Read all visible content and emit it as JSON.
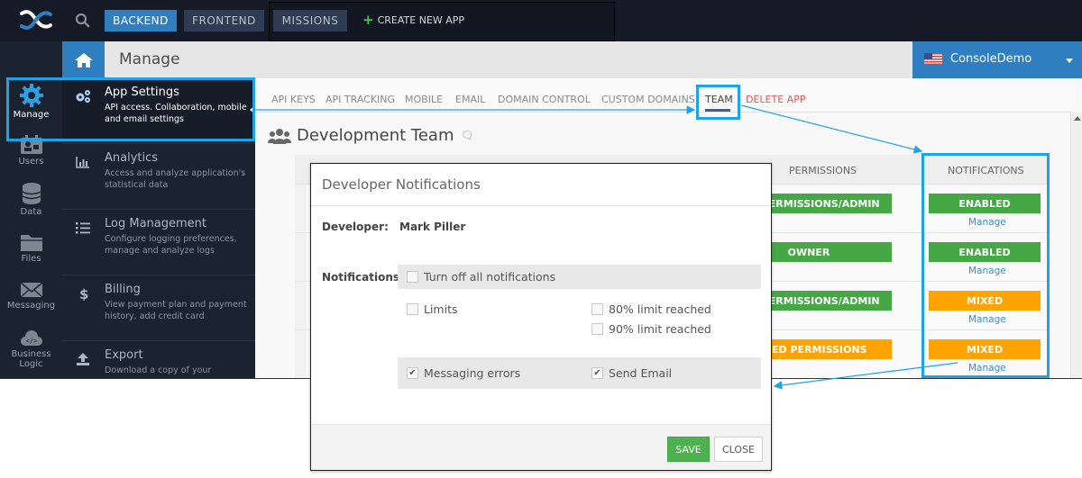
{
  "topbar": {
    "nav": [
      {
        "label": "BACKEND",
        "active": true
      },
      {
        "label": "FRONTEND",
        "active": false
      },
      {
        "label": "MISSIONS",
        "active": false
      }
    ],
    "create_app_label": "CREATE NEW APP",
    "search_icon": "search-icon",
    "logo_icon": "app-logo"
  },
  "rail": {
    "items": [
      {
        "label": "Manage",
        "icon": "gear-icon",
        "active": true
      },
      {
        "label": "Users",
        "icon": "id-card-icon"
      },
      {
        "label": "Data",
        "icon": "database-icon"
      },
      {
        "label": "Files",
        "icon": "folder-icon"
      },
      {
        "label": "Messaging",
        "icon": "envelope-icon"
      },
      {
        "label": "Business",
        "label2": "Logic",
        "icon": "cloud-code-icon"
      }
    ]
  },
  "header": {
    "title": "Manage",
    "account": "ConsoleDemo"
  },
  "submenu": {
    "items": [
      {
        "title": "App Settings",
        "desc": "API access. Collaboration, mobile and email settings",
        "icon": "cogs-icon",
        "active": true
      },
      {
        "title": "Analytics",
        "desc": "Access and analyze application's statistical data",
        "icon": "bar-chart-icon"
      },
      {
        "title": "Log Management",
        "desc": "Configure logging preferences, manage and analyze logs",
        "icon": "list-icon"
      },
      {
        "title": "Billing",
        "desc": "View payment plan and payment history, add credit card",
        "icon": "dollar-icon"
      },
      {
        "title": "Export",
        "desc": "Download a copy of your",
        "icon": "upload-icon"
      }
    ]
  },
  "tabs": [
    {
      "label": "API KEYS"
    },
    {
      "label": "API TRACKING"
    },
    {
      "label": "MOBILE"
    },
    {
      "label": "EMAIL"
    },
    {
      "label": "DOMAIN CONTROL"
    },
    {
      "label": "CUSTOM DOMAINS"
    },
    {
      "label": "TEAM",
      "active": true
    },
    {
      "label": "DELETE APP",
      "danger": true
    }
  ],
  "section": {
    "title": "Development Team"
  },
  "table": {
    "headers": {
      "permissions": "PERMISSIONS",
      "notifications": "NOTIFICATIONS"
    },
    "rows": [
      {
        "permission": "ALL PERMISSIONS/ADMIN",
        "permission_color": "green",
        "notification": "ENABLED",
        "notification_color": "green",
        "link": "Manage"
      },
      {
        "permission": "OWNER",
        "permission_color": "green",
        "notification": "ENABLED",
        "notification_color": "green",
        "link": "Manage"
      },
      {
        "permission": "ALL PERMISSIONS/ADMIN",
        "permission_color": "green",
        "notification": "MIXED",
        "notification_color": "orange",
        "link": "Manage"
      },
      {
        "permission": "MIXED PERMISSIONS",
        "permission_color": "orange",
        "notification": "MIXED",
        "notification_color": "orange",
        "link": "Manage"
      }
    ]
  },
  "modal": {
    "title": "Developer Notifications",
    "developer_label": "Developer:",
    "developer_name": "Mark Piller",
    "notifications_label": "Notifications:",
    "turn_off_all": {
      "label": "Turn off all notifications",
      "checked": false
    },
    "limits": {
      "label": "Limits",
      "checked": false
    },
    "limit_80": {
      "label": "80% limit reached",
      "checked": false
    },
    "limit_90": {
      "label": "90% limit reached",
      "checked": false
    },
    "messaging_errors": {
      "label": "Messaging errors",
      "checked": true
    },
    "send_email": {
      "label": "Send Email",
      "checked": true
    },
    "save_label": "SAVE",
    "close_label": "CLOSE"
  },
  "colors": {
    "accent": "#2f7ec0",
    "highlight": "#1ea4e6",
    "green": "#45a845",
    "orange": "#ffa300",
    "danger": "#e05a5a",
    "dark_bg": "#1b2230"
  }
}
